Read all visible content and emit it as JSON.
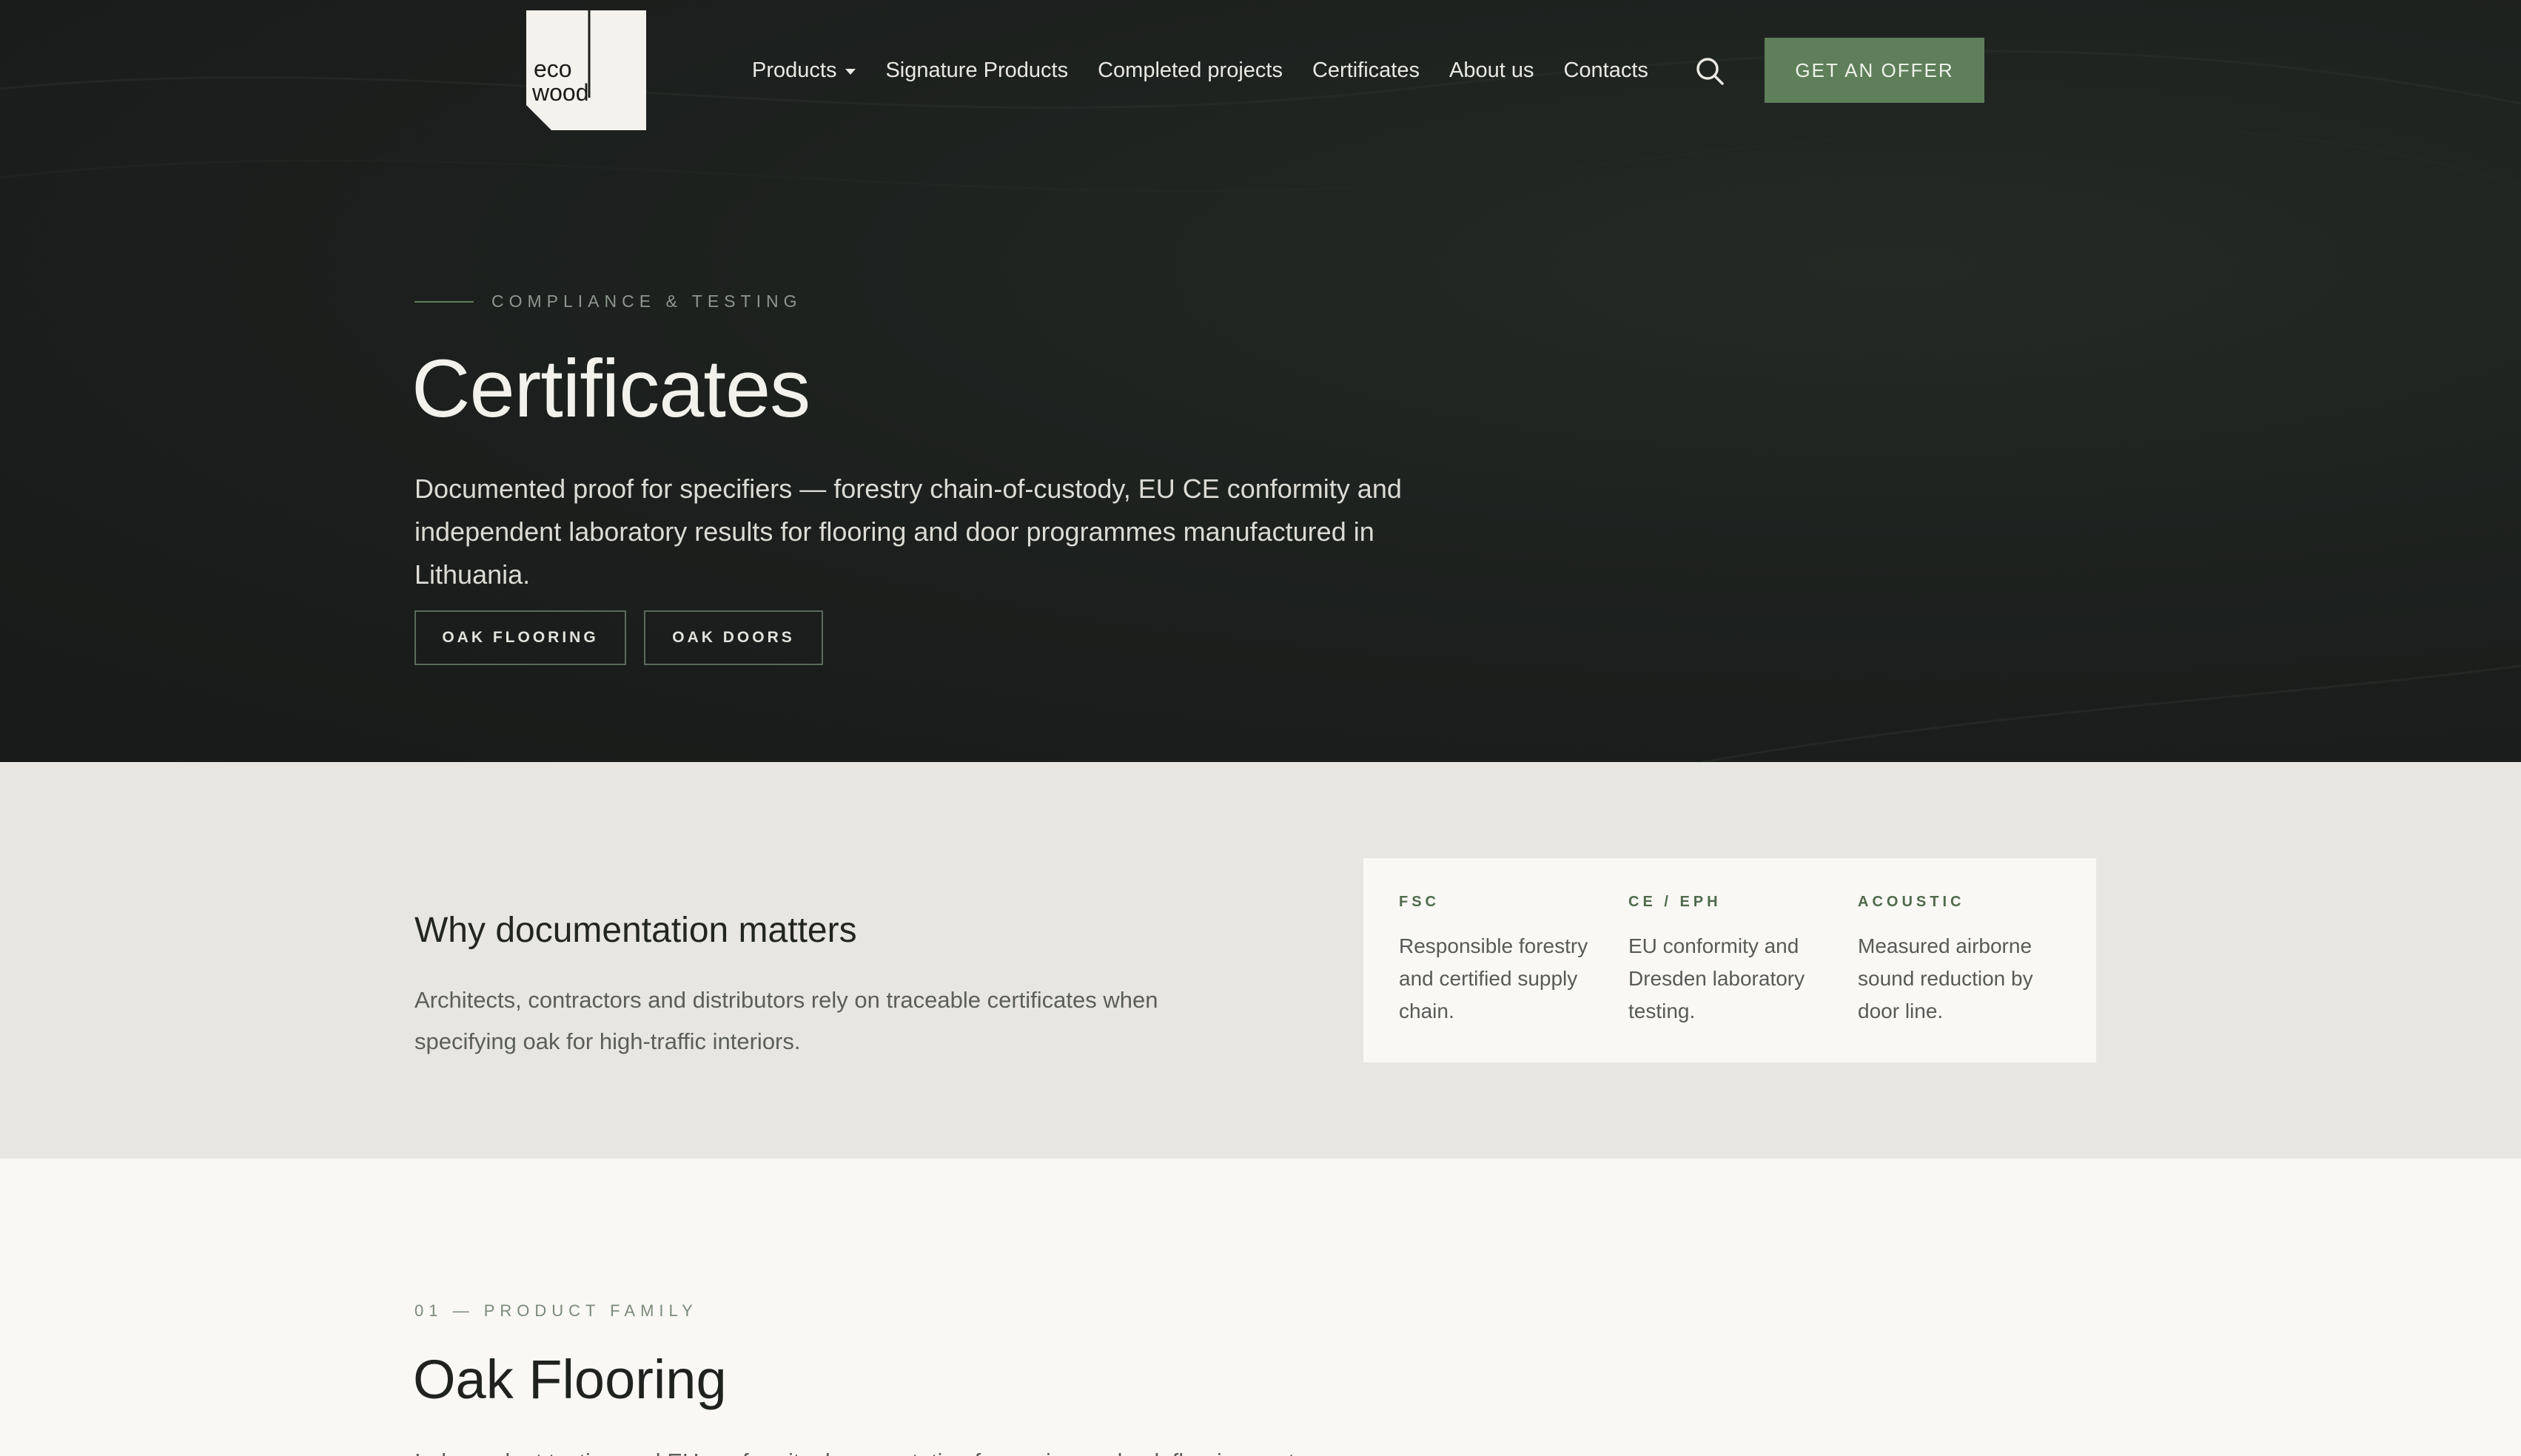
{
  "logo": {
    "line1": "eco",
    "line2": "wood"
  },
  "nav": {
    "items": [
      {
        "label": "Products",
        "has_dropdown": true
      },
      {
        "label": "Signature Products"
      },
      {
        "label": "Completed projects"
      },
      {
        "label": "Certificates"
      },
      {
        "label": "About us"
      },
      {
        "label": "Contacts"
      }
    ],
    "search_icon": "search-icon",
    "cta_label": "GET AN OFFER"
  },
  "hero": {
    "eyebrow": "COMPLIANCE & TESTING",
    "title": "Certificates",
    "description": "Documented proof for specifiers — forestry chain-of-custody, EU CE conformity and independent laboratory results for flooring and door programmes manufactured in Lithuania.",
    "buttons": [
      "OAK FLOORING",
      "OAK DOORS"
    ]
  },
  "why": {
    "title": "Why documentation matters",
    "description": "Architects, contractors and distributors rely on traceable certificates when specifying oak for high-traffic interiors.",
    "cards": [
      {
        "label": "FSC",
        "body": "Responsible forestry and certified supply chain."
      },
      {
        "label": "CE / EPH",
        "body": "EU conformity and Dresden laboratory testing."
      },
      {
        "label": "ACOUSTIC",
        "body": "Measured airborne sound reduction by door line."
      }
    ]
  },
  "family": {
    "eyebrow": "01 — PRODUCT FAMILY",
    "title": "Oak Flooring",
    "description": "Independent testing and EU conformity documentation for engineered oak flooring systems."
  },
  "colors": {
    "accent": "#5e7f5a",
    "hero_bg": "#1c1f1d",
    "section_bg": "#e8e6e2",
    "page_bg": "#f9f8f5"
  }
}
